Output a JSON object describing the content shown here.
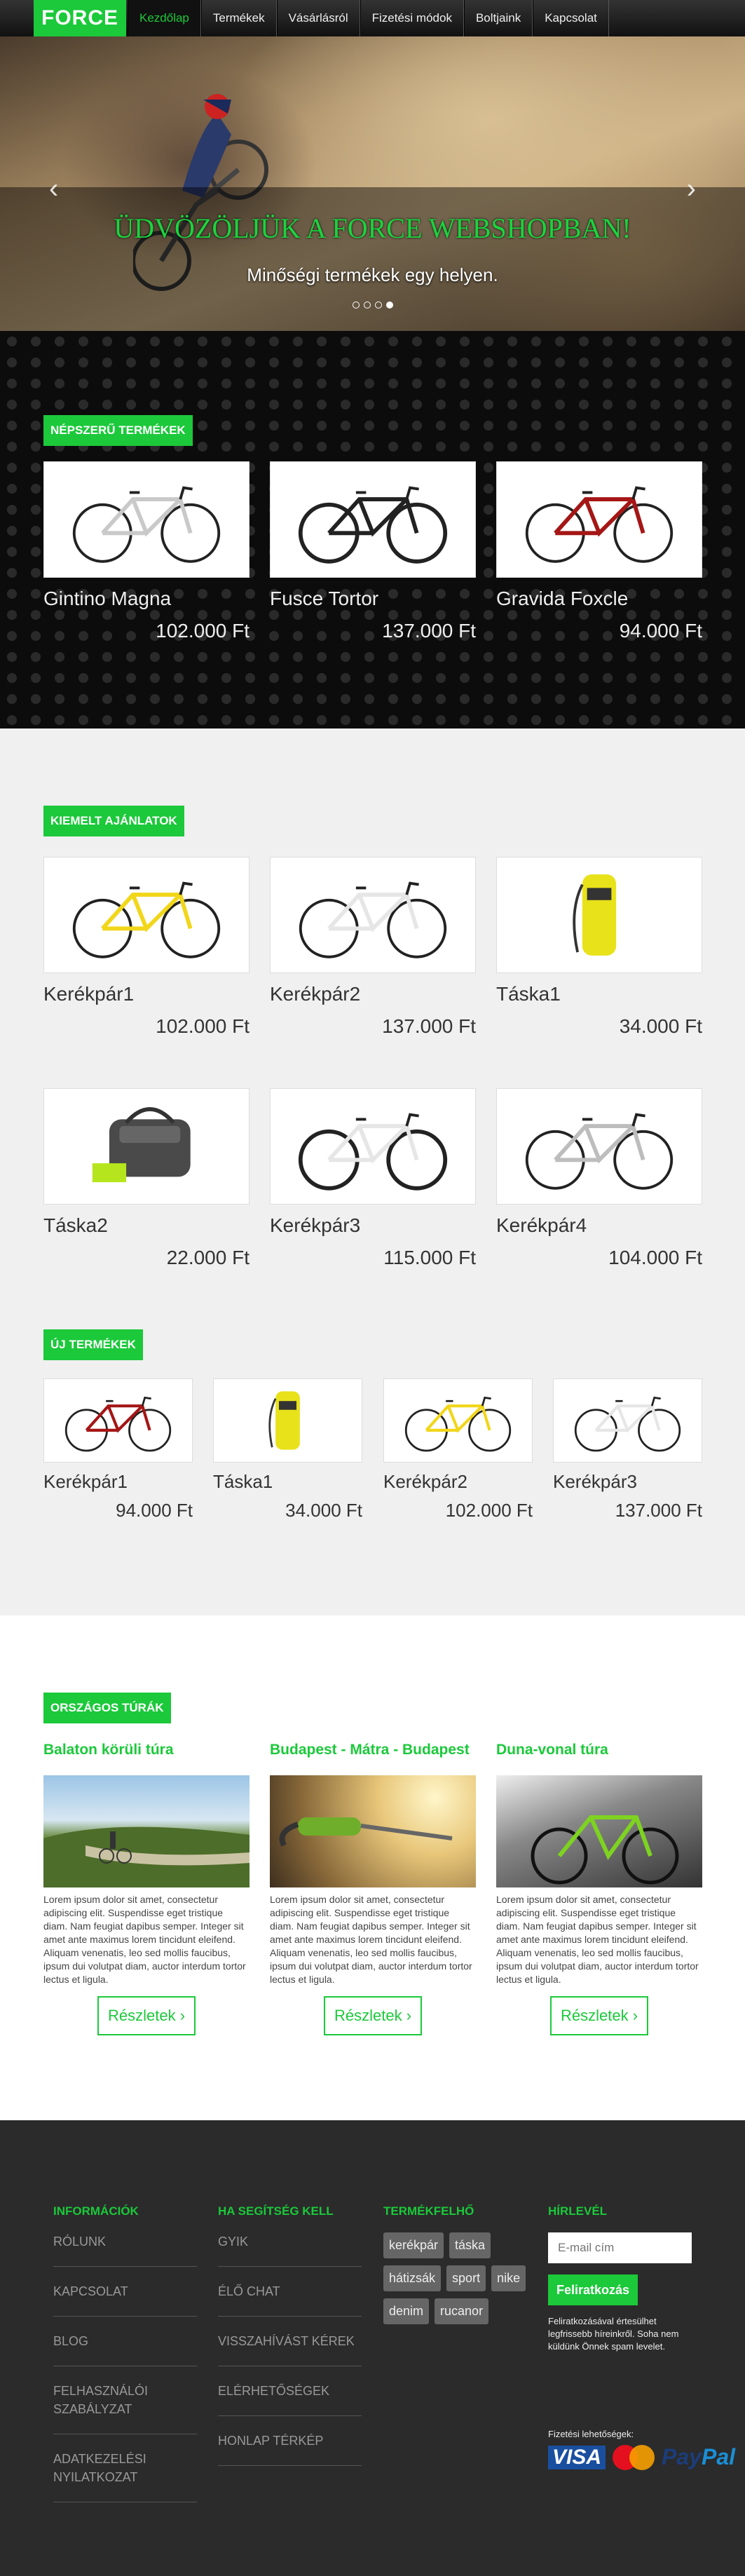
{
  "nav": {
    "brand": "FORCE",
    "items": [
      "Kezdőlap",
      "Termékek",
      "Vásárlásról",
      "Fizetési módok",
      "Boltjaink",
      "Kapcsolat"
    ]
  },
  "hero": {
    "title": "Üdvözöljük a Force webshopban!",
    "subtitle": "Minőségi termékek egy helyen.",
    "slides": 4,
    "active_slide": 4
  },
  "popular": {
    "title": "Népszerű termékek",
    "items": [
      {
        "name": "Gintino Magna",
        "price": "102.000 Ft",
        "icon": "road-bike-icon"
      },
      {
        "name": "Fusce Tortor",
        "price": "137.000 Ft",
        "icon": "mountain-bike-icon"
      },
      {
        "name": "Gravida Foxcle",
        "price": "94.000 Ft",
        "icon": "road-bike-icon"
      }
    ]
  },
  "featured": {
    "title": "Kiemelt ajánlatok",
    "items": [
      {
        "name": "Kerékpár1",
        "price": "102.000 Ft",
        "icon": "road-bike-icon"
      },
      {
        "name": "Kerékpár2",
        "price": "137.000 Ft",
        "icon": "road-bike-icon"
      },
      {
        "name": "Táska1",
        "price": "34.000 Ft",
        "icon": "backpack-icon"
      },
      {
        "name": "Táska2",
        "price": "22.000 Ft",
        "icon": "bag-icon"
      },
      {
        "name": "Kerékpár3",
        "price": "115.000 Ft",
        "icon": "mountain-bike-icon"
      },
      {
        "name": "Kerékpár4",
        "price": "104.000 Ft",
        "icon": "road-bike-icon"
      }
    ]
  },
  "new": {
    "title": "Új termékek",
    "items": [
      {
        "name": "Kerékpár1",
        "price": "94.000 Ft",
        "icon": "road-bike-icon"
      },
      {
        "name": "Táska1",
        "price": "34.000 Ft",
        "icon": "backpack-icon"
      },
      {
        "name": "Kerékpár2",
        "price": "102.000 Ft",
        "icon": "road-bike-icon"
      },
      {
        "name": "Kerékpár3",
        "price": "137.000 Ft",
        "icon": "road-bike-icon"
      }
    ]
  },
  "tours": {
    "title": "Országos túrák",
    "button": "Részletek",
    "items": [
      {
        "title": "Balaton körüli túra",
        "text": "Lorem ipsum dolor sit amet, consectetur adipiscing elit. Suspendisse eget tristique diam. Nam feugiat dapibus semper. Integer sit amet ante maximus lorem tincidunt eleifend. Aliquam venenatis, leo sed mollis faucibus, ipsum dui volutpat diam, auctor interdum tortor lectus et ligula."
      },
      {
        "title": "Budapest - Mátra - Budapest",
        "text": "Lorem ipsum dolor sit amet, consectetur adipiscing elit. Suspendisse eget tristique diam. Nam feugiat dapibus semper. Integer sit amet ante maximus lorem tincidunt eleifend. Aliquam venenatis, leo sed mollis faucibus, ipsum dui volutpat diam, auctor interdum tortor lectus et ligula."
      },
      {
        "title": "Duna-vonal túra",
        "text": "Lorem ipsum dolor sit amet, consectetur adipiscing elit. Suspendisse eget tristique diam. Nam feugiat dapibus semper. Integer sit amet ante maximus lorem tincidunt eleifend. Aliquam venenatis, leo sed mollis faucibus, ipsum dui volutpat diam, auctor interdum tortor lectus et ligula."
      }
    ]
  },
  "footer": {
    "info": {
      "title": "Információk",
      "links": [
        "Rólunk",
        "Kapcsolat",
        "Blog",
        "Felhasználói szabályzat",
        "Adatkezelési nyilatkozat"
      ]
    },
    "help": {
      "title": "Ha segítség kell",
      "links": [
        "GYIK",
        "Élő chat",
        "Visszahívást kérek",
        "Elérhetőségek",
        "Honlap térkép"
      ]
    },
    "tags": {
      "title": "Termékfelhő",
      "items": [
        "kerékpár",
        "táska",
        "hátizsák",
        "sport",
        "nike",
        "denim",
        "rucanor"
      ]
    },
    "newsletter": {
      "title": "Hírlevél",
      "placeholder": "E-mail cím",
      "button": "Feliratkozás",
      "note": "Feliratkozásával értesülhet legfrissebb híreinkről. Soha nem küldünk Önnek spam levelet."
    },
    "payment": {
      "note": "Fizetési lehetőségek:",
      "visa": "VISA",
      "mastercard": "MasterCard",
      "paypal_a": "Pay",
      "paypal_b": "Pal"
    }
  },
  "colors": {
    "accent": "#1bc93a",
    "dark": "#0c0c0c",
    "footer": "#2b2b2b"
  }
}
